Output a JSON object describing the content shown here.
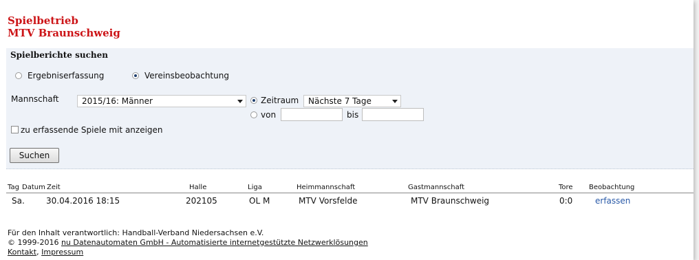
{
  "header": {
    "line1": "Spielbetrieb",
    "line2": "MTV Braunschweig"
  },
  "search": {
    "heading": "Spielberichte suchen",
    "mode_options": [
      {
        "label": "Ergebniserfassung",
        "checked": false
      },
      {
        "label": "Vereinsbeobachtung",
        "checked": true
      }
    ],
    "team_label": "Mannschaft",
    "team_value": "2015/16: Männer",
    "range_label": "Zeitraum",
    "range_value": "Nächste 7 Tage",
    "from_label": "von",
    "from_value": "",
    "to_label": "bis",
    "to_value": "",
    "include_label": "zu erfassende Spiele mit anzeigen",
    "include_checked": false,
    "submit_label": "Suchen"
  },
  "table": {
    "headers": {
      "tag": "Tag",
      "datum": "Datum",
      "zeit": "Zeit",
      "halle": "Halle",
      "liga": "Liga",
      "heim": "Heimmannschaft",
      "gast": "Gastmannschaft",
      "tore": "Tore",
      "beobachtung": "Beobachtung"
    },
    "rows": [
      {
        "tag": "Sa.",
        "datum_zeit": "30.04.2016 18:15",
        "halle": "202105",
        "liga": "OL M",
        "heim": "MTV Vorsfelde",
        "gast": "MTV Braunschweig",
        "tore": "0:0",
        "action": "erfassen"
      }
    ]
  },
  "footer": {
    "responsible": "Für den Inhalt verantwortlich: Handball-Verband Niedersachsen e.V.",
    "copyright_prefix": "© 1999-2016 ",
    "copyright_link": "nu Datenautomaten GmbH - Automatisierte internetgestützte Netzwerklösungen",
    "contact": "Kontakt",
    "separator": ", ",
    "imprint": "Impressum"
  },
  "colors": {
    "title": "#cc1417",
    "panel": "#eef2f8",
    "link": "#2a5aa8"
  }
}
